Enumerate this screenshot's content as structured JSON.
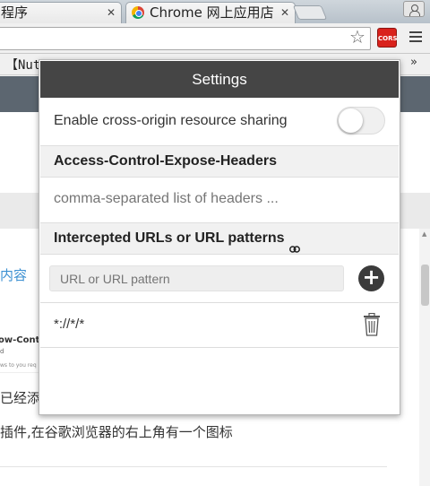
{
  "browser": {
    "tabs": [
      {
        "title": "程序"
      },
      {
        "title": "Chrome 网上应用店"
      }
    ],
    "bookmark_bar_text": "【Nut",
    "bookmark_overflow": "»",
    "extension_badge": "CORS"
  },
  "page": {
    "link_text": "内容",
    "image_line1": "ow-Contro",
    "image_line2": "d",
    "image_line3": "ws to you req",
    "text1": "已经添",
    "text2": "插件,在谷歌浏览器的右上角有一个图标"
  },
  "popup": {
    "title": "Settings",
    "toggle_label": "Enable cross-origin resource sharing",
    "toggle_on": false,
    "expose_headers_title": "Access-Control-Expose-Headers",
    "expose_headers_placeholder": "comma-separated list of headers ...",
    "intercepted_title": "Intercepted URLs or URL patterns",
    "url_placeholder": "URL or URL pattern",
    "patterns": [
      "*://*/*"
    ]
  },
  "colors": {
    "header_bg": "#454545",
    "section_bg": "#f1f1f1",
    "cors_red": "#d9221c",
    "link_blue": "#3a8fd1"
  },
  "icons": {
    "bookmark": "star-icon",
    "menu": "hamburger-menu-icon",
    "add": "plus-circle-icon",
    "delete": "trash-icon",
    "link": "link-icon"
  }
}
